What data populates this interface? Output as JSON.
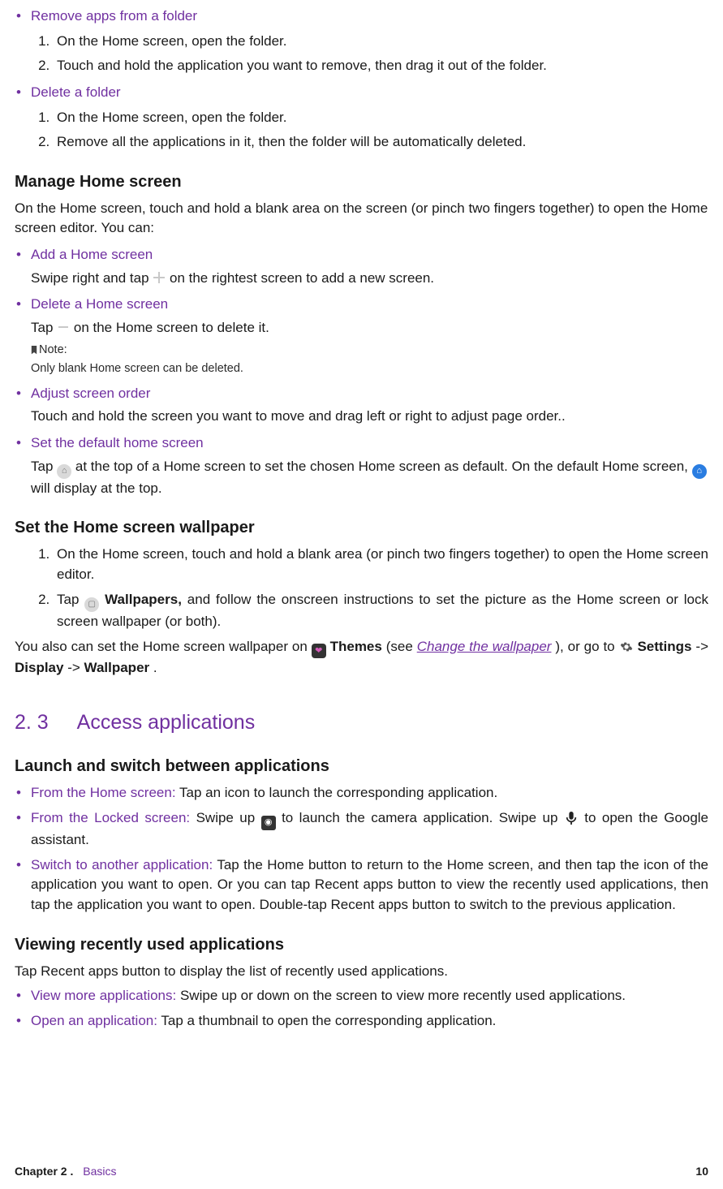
{
  "top_sections": [
    {
      "title": "Remove apps from a folder",
      "steps": [
        "On the Home screen, open the folder.",
        "Touch and hold the application you want to remove, then drag it out of the folder."
      ]
    },
    {
      "title": "Delete a folder",
      "steps": [
        "On the Home screen, open the folder.",
        "Remove all the applications in it, then the folder will be automatically deleted."
      ]
    }
  ],
  "manage": {
    "heading": "Manage Home screen",
    "intro": "On the Home screen, touch and hold a blank area on the screen (or pinch two fingers together) to open the Home screen editor. You can:",
    "items": {
      "add": {
        "title": "Add a Home screen",
        "before": "Swipe right and tap ",
        "after": " on the rightest screen to add a new screen."
      },
      "delete": {
        "title": "Delete a Home screen",
        "before": "Tap ",
        "after": " on the Home screen to delete it.",
        "note_label": "Note:",
        "note_body": "Only blank Home screen can be deleted."
      },
      "adjust": {
        "title": "Adjust screen order",
        "body": "Touch and hold the screen you want to move and drag left or right to adjust page order.."
      },
      "default": {
        "title": "Set the default home screen",
        "p1_before": "Tap ",
        "p1_after": " at the top of a Home screen to set the chosen Home screen as default. On the default Home screen, ",
        "p1_tail": " will display at the top."
      }
    }
  },
  "wallpaper": {
    "heading": "Set the Home screen wallpaper",
    "step1": "On the Home screen, touch and hold a blank area (or pinch two fingers together) to open the Home screen editor.",
    "step2_before": "Tap ",
    "step2_bold": " Wallpapers,",
    "step2_after": " and follow the onscreen instructions to set the picture as the Home screen or lock screen wallpaper (or both).",
    "also_before": "You also can set the Home screen wallpaper on ",
    "themes_label": " Themes",
    "also_mid": " (see ",
    "link": "Change the wallpaper",
    "also_after1": "), or go to ",
    "settings_label": " Settings",
    "also_after2": " -> ",
    "display": "Display",
    "arrow": " -> ",
    "wp": "Wallpaper",
    "period": "."
  },
  "section23": {
    "num": "2. 3",
    "title": "Access applications"
  },
  "launch": {
    "heading": "Launch and switch between applications",
    "items": {
      "home": {
        "lead": "From the Home screen:",
        "rest": " Tap an icon to launch the corresponding application."
      },
      "locked": {
        "lead": "From the Locked screen:",
        "p1": " Swipe up ",
        "p2": " to launch the camera application. Swipe up ",
        "p3": " to open the Google assistant."
      },
      "switch": {
        "lead": "Switch to another application:",
        "rest": " Tap the Home button to return to the Home screen, and then tap the icon of the application you want to open. Or you can tap Recent apps button to view the recently used applications, then tap the application you want to open. Double-tap Recent apps button to switch to the previous application."
      }
    }
  },
  "recent": {
    "heading": "Viewing recently used applications",
    "intro": "Tap Recent apps button to display the list of recently used applications.",
    "items": {
      "view": {
        "lead": "View more applications:",
        "rest": " Swipe up or down on the screen to view more recently used applications."
      },
      "open": {
        "lead": "Open an application:",
        "rest": " Tap a thumbnail to open the corresponding application."
      }
    }
  },
  "footer": {
    "chapter": "Chapter 2 .",
    "name": "Basics",
    "page": "10"
  }
}
